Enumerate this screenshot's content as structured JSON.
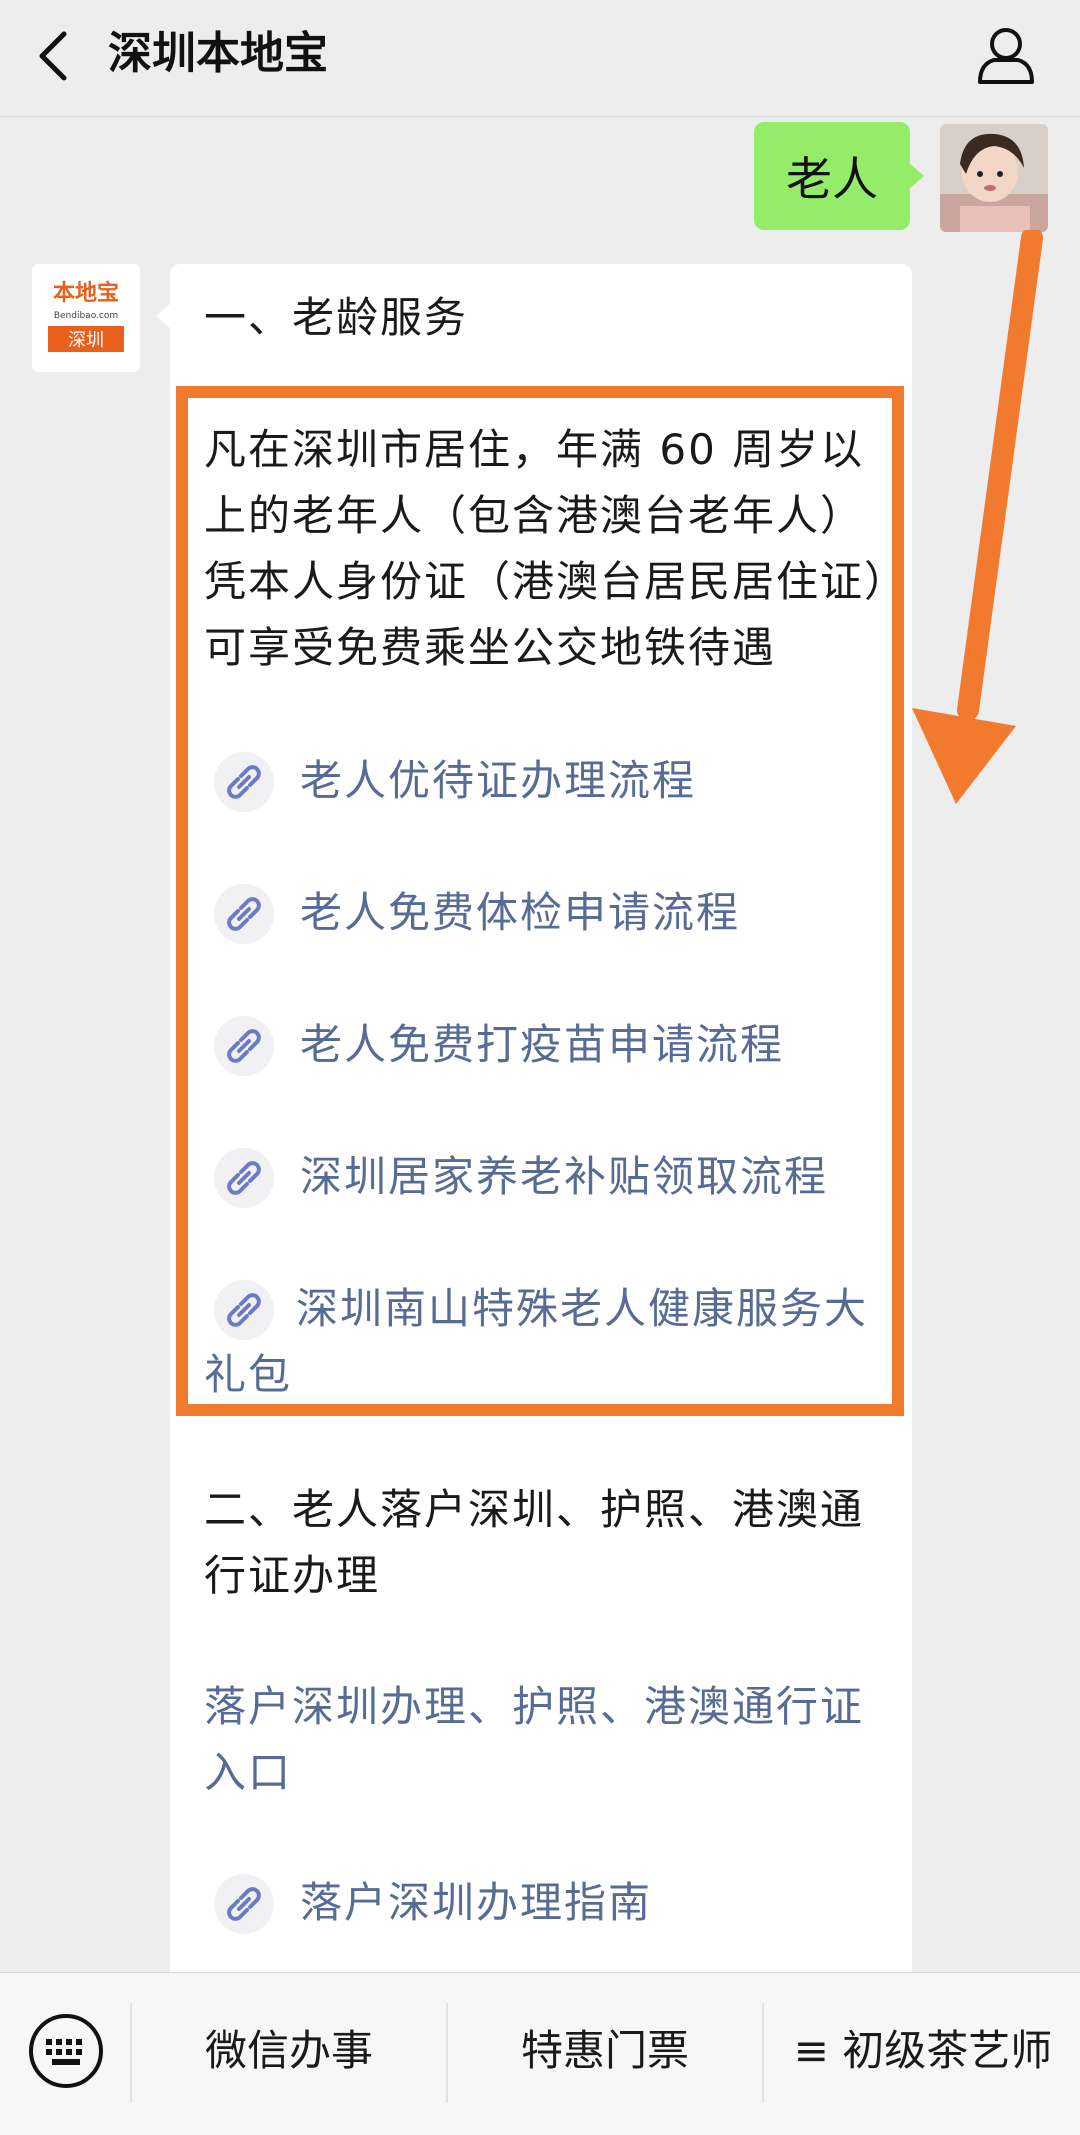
{
  "header": {
    "title": "深圳本地宝"
  },
  "user_message": {
    "text": "老人"
  },
  "bot": {
    "avatar_text_top": "本地宝",
    "avatar_text_mid": "Bendibao.com",
    "avatar_text_bottom": "深圳",
    "section1_title": "一、老龄服务",
    "intro_lines": [
      "凡在深圳市居住，年满 60 周岁以",
      "上的老年人（包含港澳台老年人）",
      "凭本人身份证（港澳台居民居住证）",
      "可享受免费乘坐公交地铁待遇"
    ],
    "links": [
      "老人优待证办理流程",
      "老人免费体检申请流程",
      "老人免费打疫苗申请流程",
      "深圳居家养老补贴领取流程",
      "深圳南山特殊老人健康服务大"
    ],
    "link5_wrap": "礼包",
    "section2_title_line1": "二、老人落户深圳、护照、港澳通",
    "section2_title_line2": "行证办理",
    "section2_link_line1": "落户深圳办理、护照、港澳通行证",
    "section2_link_line2": "入口",
    "section2_link2": "落户深圳办理指南"
  },
  "bottom_menu": {
    "item1": "微信办事",
    "item2": "特惠门票",
    "item3": "≡ 初级茶艺师"
  },
  "colors": {
    "highlight": "#f27a2e",
    "link": "#576b95",
    "user_bubble": "#95ec69"
  }
}
